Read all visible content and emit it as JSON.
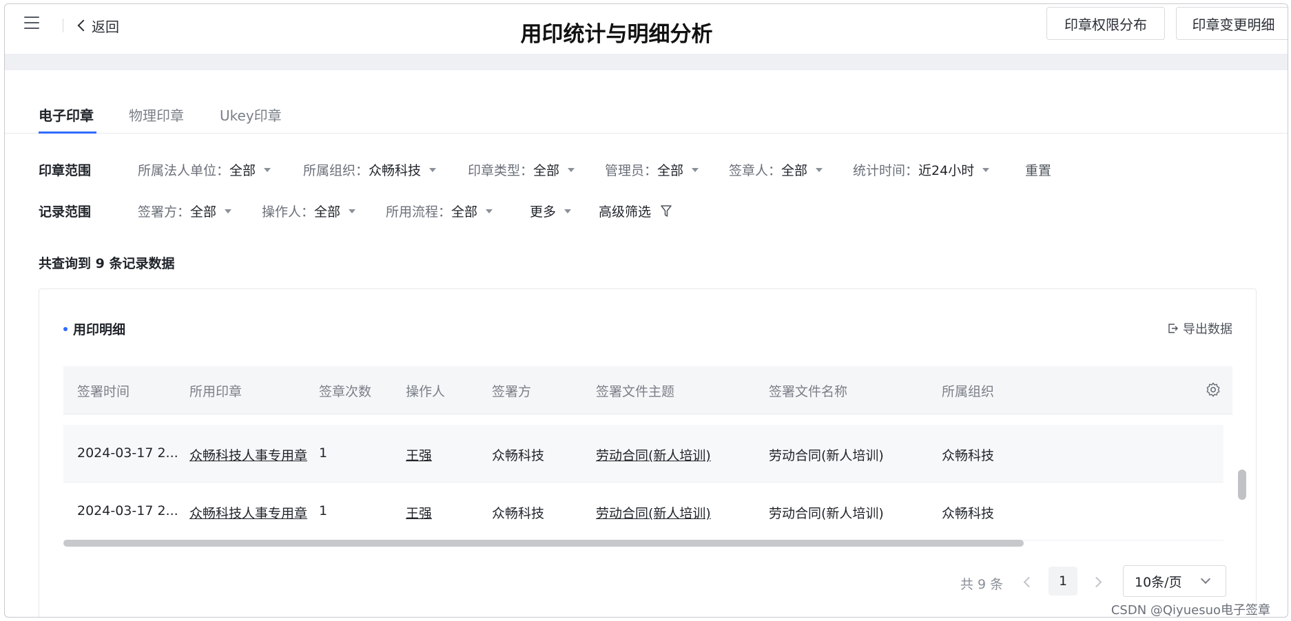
{
  "header": {
    "back_label": "返回",
    "title": "用印统计与明细分析",
    "buttons": [
      "印章权限分布",
      "印章变更明细"
    ]
  },
  "tabs": [
    {
      "label": "电子印章",
      "active": true
    },
    {
      "label": "物理印章",
      "active": false
    },
    {
      "label": "Ukey印章",
      "active": false
    }
  ],
  "filters": {
    "seal_scope": {
      "title": "印章范围",
      "items": [
        {
          "label": "所属法人单位：",
          "value": "全部"
        },
        {
          "label": "所属组织：",
          "value": "众畅科技"
        },
        {
          "label": "印章类型：",
          "value": "全部"
        },
        {
          "label": "管理员：",
          "value": "全部"
        },
        {
          "label": "签章人：",
          "value": "全部"
        },
        {
          "label": "统计时间：",
          "value": "近24小时"
        }
      ],
      "reset": "重置"
    },
    "record_scope": {
      "title": "记录范围",
      "items": [
        {
          "label": "签署方：",
          "value": "全部"
        },
        {
          "label": "操作人：",
          "value": "全部"
        },
        {
          "label": "所用流程：",
          "value": "全部"
        }
      ],
      "more": "更多",
      "advanced": "高级筛选"
    }
  },
  "summary": "共查询到 9 条记录数据",
  "detail": {
    "title": "用印明细",
    "export": "导出数据",
    "columns": [
      "签署时间",
      "所用印章",
      "签章次数",
      "操作人",
      "签署方",
      "签署文件主题",
      "签署文件名称",
      "所属组织"
    ],
    "rows": [
      [
        "2024-03-17 2...",
        "众畅科技人事专用章",
        "1",
        "王强",
        "众畅科技",
        "劳动合同(新人培训)",
        "劳动合同(新人培训)",
        "众畅科技"
      ],
      [
        "2024-03-17 2...",
        "众畅科技人事专用章",
        "1",
        "王强",
        "众畅科技",
        "劳动合同(新人培训)",
        "劳动合同(新人培训)",
        "众畅科技"
      ]
    ]
  },
  "pagination": {
    "total": "共 9 条",
    "current_page": "1",
    "page_size": "10条/页"
  },
  "watermark": "CSDN @Qiyuesuo电子签章",
  "colors": {
    "accent": "#2f6bff"
  }
}
